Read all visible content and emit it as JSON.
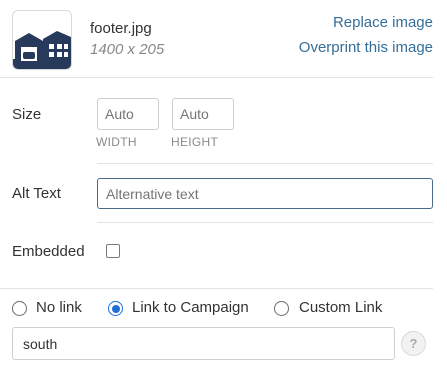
{
  "image": {
    "filename": "footer.jpg",
    "dimensions": "1400 x 205",
    "replace_label": "Replace image",
    "overprint_label": "Overprint this image",
    "thumbnail_icon": "house-photo-icon"
  },
  "size": {
    "label": "Size",
    "width_placeholder": "Auto",
    "height_placeholder": "Auto",
    "width_caption": "WIDTH",
    "height_caption": "HEIGHT"
  },
  "alt_text": {
    "label": "Alt Text",
    "placeholder": "Alternative text"
  },
  "embedded": {
    "label": "Embedded",
    "checked": false
  },
  "link": {
    "options": [
      {
        "label": "No link",
        "selected": false
      },
      {
        "label": "Link to Campaign",
        "selected": true
      },
      {
        "label": "Custom Link",
        "selected": false
      }
    ],
    "value": "south",
    "help_symbol": "?"
  },
  "colors": {
    "link": "#346f99",
    "radio_selected": "#1f6fd6",
    "focus_border": "#4a6b89",
    "thumbnail_dark": "#273a5c"
  }
}
